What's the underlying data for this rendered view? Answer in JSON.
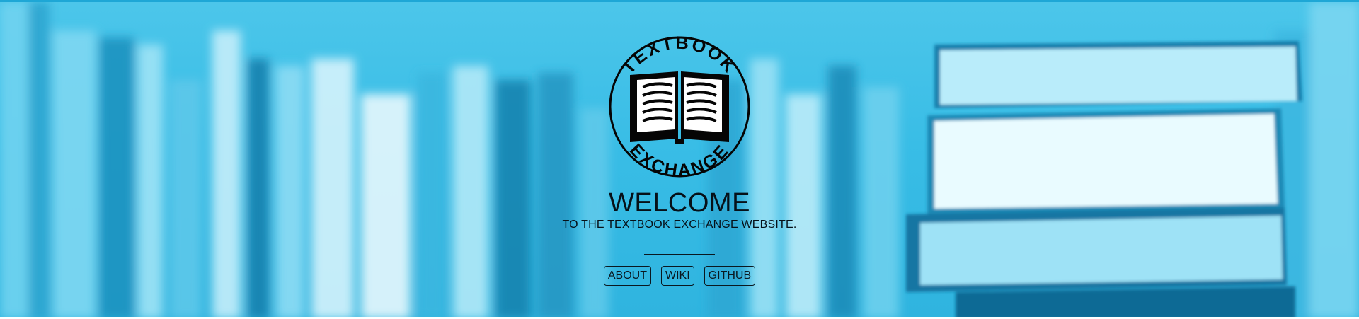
{
  "hero": {
    "logo": {
      "top_text": "TEXTBOOK",
      "bottom_text": "EXCHANGE",
      "icon": "open-book-icon"
    },
    "title": "WELCOME",
    "subtitle": "TO THE TEXTBOOK EXCHANGE WEBSITE.",
    "nav": [
      {
        "label": "ABOUT"
      },
      {
        "label": "WIKI"
      },
      {
        "label": "GITHUB"
      }
    ]
  },
  "colors": {
    "hero_bg": "#39bde6",
    "text": "#061018"
  }
}
